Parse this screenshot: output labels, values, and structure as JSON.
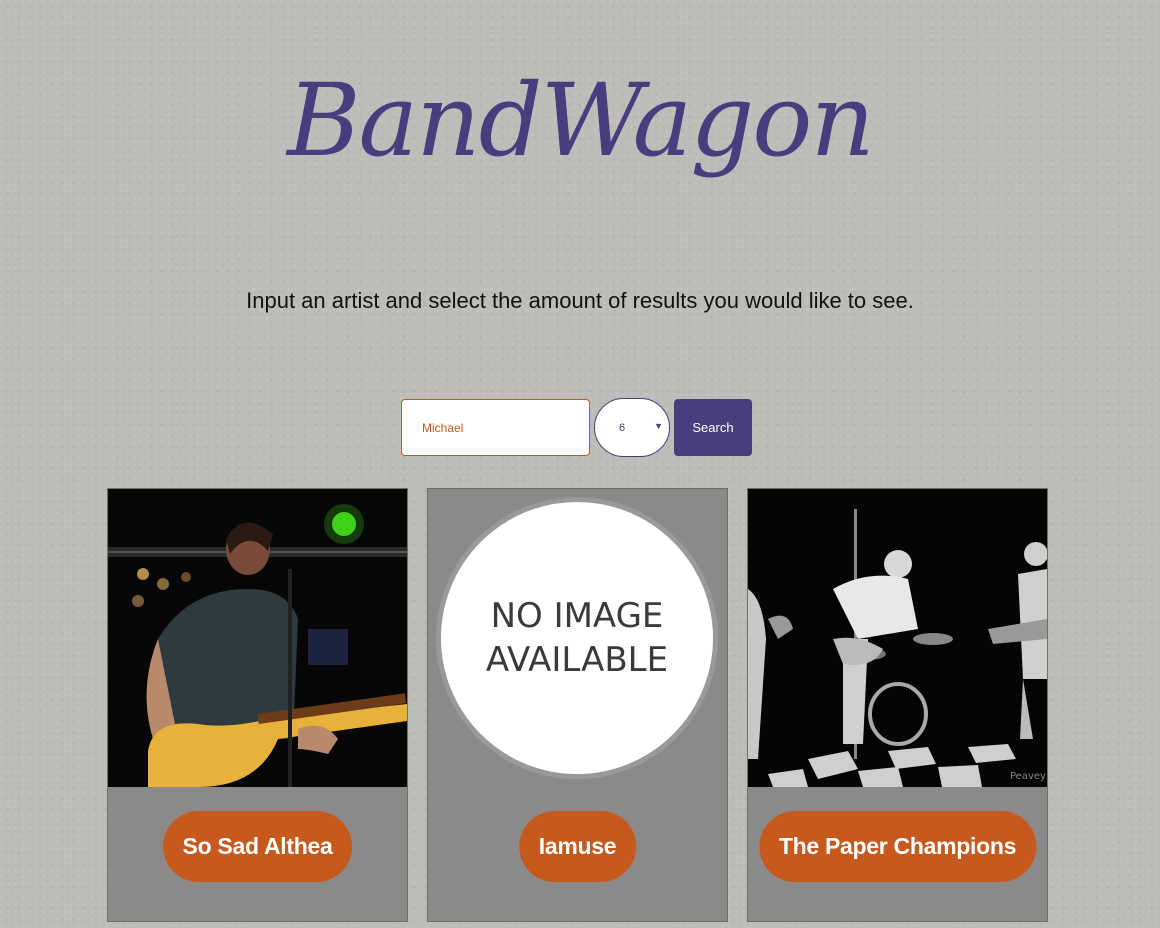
{
  "header": {
    "title": "BandWagon",
    "subtitle": "Input an artist and select the amount of results you would like to see."
  },
  "search": {
    "value": "Michael",
    "count": "6",
    "button_label": "Search"
  },
  "results": [
    {
      "name": "So Sad Althea",
      "image": "band-photo"
    },
    {
      "name": "Iamuse",
      "image": "no-image",
      "placeholder_text": "NO IMAGE AVAILABLE"
    },
    {
      "name": "The Paper Champions",
      "image": "band-photo"
    }
  ],
  "colors": {
    "brand": "#4a3d7e",
    "accent": "#c65a1e",
    "background": "#bebcb8",
    "card": "#8c8a88"
  }
}
